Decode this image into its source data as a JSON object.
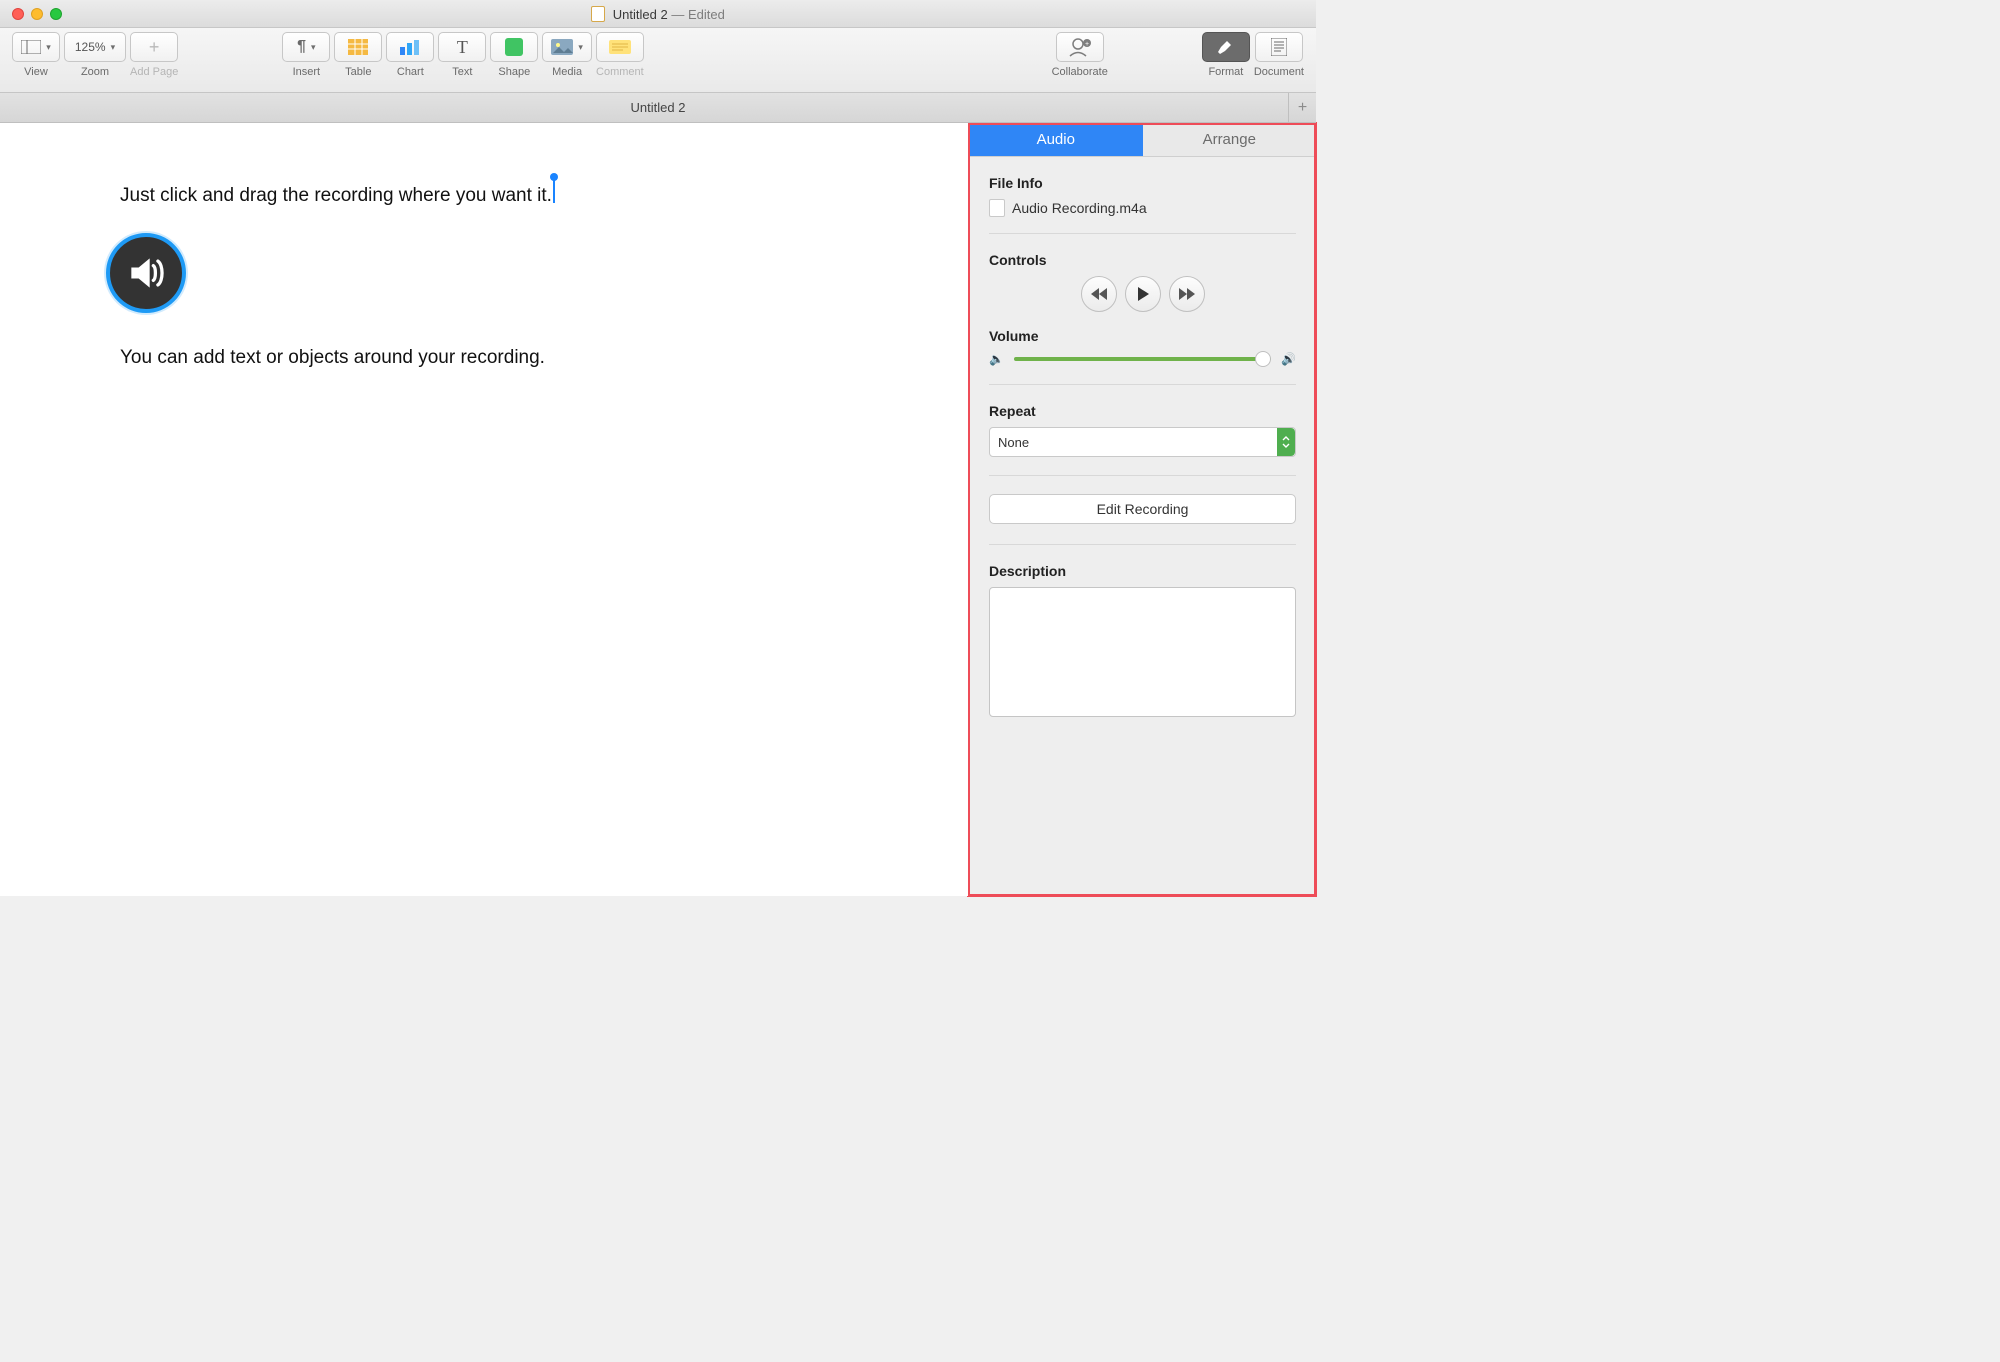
{
  "title": {
    "doc_name": "Untitled 2",
    "suffix": " — Edited"
  },
  "toolbar": {
    "view": "View",
    "zoom": "Zoom",
    "zoom_value": "125%",
    "add_page": "Add Page",
    "insert": "Insert",
    "table": "Table",
    "chart": "Chart",
    "text": "Text",
    "shape": "Shape",
    "media": "Media",
    "comment": "Comment",
    "collaborate": "Collaborate",
    "format": "Format",
    "document": "Document"
  },
  "tabstrip": {
    "tab1": "Untitled 2"
  },
  "document_body": {
    "line1": "Just click and drag the recording where you want it.",
    "line2": "You can add text or objects around your recording."
  },
  "inspector": {
    "tab_audio": "Audio",
    "tab_arrange": "Arrange",
    "file_info_title": "File Info",
    "file_name": "Audio Recording.m4a",
    "controls_title": "Controls",
    "volume_title": "Volume",
    "repeat_title": "Repeat",
    "repeat_value": "None",
    "edit_recording": "Edit Recording",
    "description_title": "Description"
  }
}
